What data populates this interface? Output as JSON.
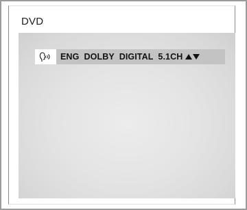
{
  "window": {
    "title": "DVD"
  },
  "osd": {
    "icon": "speaking-head-icon",
    "audio_label": "ENG  DOLBY  DIGITAL  5.1CH",
    "arrows_icon": "up-down-arrows-icon"
  },
  "colors": {
    "bar_background": "#c3c3c3",
    "screen_background": "#e4e4e4",
    "frame_border": "#9a9a9a"
  }
}
